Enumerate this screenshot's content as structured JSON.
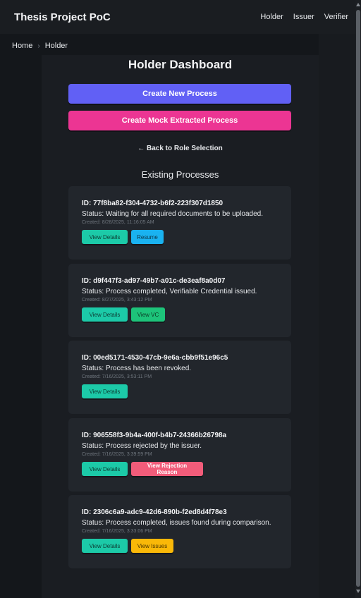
{
  "navbar": {
    "brand": "Thesis Project PoC",
    "links": [
      "Holder",
      "Issuer",
      "Verifier"
    ]
  },
  "breadcrumb": [
    "Home",
    "Holder"
  ],
  "page": {
    "title": "Holder Dashboard",
    "create_button": "Create New Process",
    "mock_button": "Create Mock Extracted Process",
    "back_link": "← Back to Role Selection",
    "section_title": "Existing Processes"
  },
  "processes": [
    {
      "id": "ID: 77f8ba82-f304-4732-b6f2-223f307d1850",
      "status": "Status: Waiting for all required documents to be uploaded.",
      "created": "Created: 8/28/2025, 11:16:05 AM",
      "actions": [
        "View Details",
        "Resume"
      ]
    },
    {
      "id": "ID: d9f447f3-ad97-49b7-a01c-de3eaf8a0d07",
      "status": "Status: Process completed, Verifiable Credential issued.",
      "created": "Created: 8/27/2025, 3:43:12 PM",
      "actions": [
        "View Details",
        "View VC"
      ]
    },
    {
      "id": "ID: 00ed5171-4530-47cb-9e6a-cbb9f51e96c5",
      "status": "Status: Process has been revoked.",
      "created": "Created: 7/16/2025, 3:53:11 PM",
      "actions": [
        "View Details"
      ]
    },
    {
      "id": "ID: 906558f3-9b4a-400f-b4b7-24366b26798a",
      "status": "Status: Process rejected by the issuer.",
      "created": "Created: 7/16/2025, 3:39:59 PM",
      "actions": [
        "View Details",
        "View Rejection Reason"
      ]
    },
    {
      "id": "ID: 2306c6a9-adc9-42d6-890b-f2ed8d4f78e3",
      "status": "Status: Process completed, issues found during comparison.",
      "created": "Created: 7/16/2025, 3:33:06 PM",
      "actions": [
        "View Details",
        "View Issues"
      ]
    }
  ],
  "colors": {
    "primary": "#6160f5",
    "mock": "#ec3593",
    "details": "#1ccaa8",
    "resume": "#1ab2f0",
    "vc": "#1dc47a",
    "reject": "#f25c7a",
    "issues": "#f9b808"
  }
}
